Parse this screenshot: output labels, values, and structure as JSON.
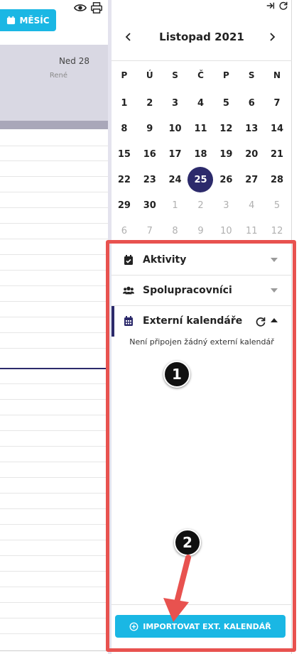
{
  "toolbar": {
    "month_label": "MĚSÍC",
    "view_icon": "eye-icon",
    "print_icon": "printer-icon"
  },
  "day_view": {
    "day_label": "Ned 28",
    "person": "René"
  },
  "mini_calendar": {
    "title": "Listopad 2021",
    "weekdays": [
      "P",
      "Ú",
      "S",
      "Č",
      "P",
      "S",
      "N"
    ],
    "days": [
      {
        "n": "1"
      },
      {
        "n": "2"
      },
      {
        "n": "3"
      },
      {
        "n": "4"
      },
      {
        "n": "5"
      },
      {
        "n": "6"
      },
      {
        "n": "7"
      },
      {
        "n": "8"
      },
      {
        "n": "9"
      },
      {
        "n": "10"
      },
      {
        "n": "11"
      },
      {
        "n": "12"
      },
      {
        "n": "13"
      },
      {
        "n": "14"
      },
      {
        "n": "15"
      },
      {
        "n": "16"
      },
      {
        "n": "17"
      },
      {
        "n": "18"
      },
      {
        "n": "19"
      },
      {
        "n": "20"
      },
      {
        "n": "21"
      },
      {
        "n": "22"
      },
      {
        "n": "23"
      },
      {
        "n": "24"
      },
      {
        "n": "25",
        "today": true
      },
      {
        "n": "26"
      },
      {
        "n": "27"
      },
      {
        "n": "28"
      },
      {
        "n": "29"
      },
      {
        "n": "30"
      },
      {
        "n": "1",
        "muted": true
      },
      {
        "n": "2",
        "muted": true
      },
      {
        "n": "3",
        "muted": true
      },
      {
        "n": "4",
        "muted": true
      },
      {
        "n": "5",
        "muted": true
      },
      {
        "n": "6",
        "muted": true
      },
      {
        "n": "7",
        "muted": true
      },
      {
        "n": "8",
        "muted": true
      },
      {
        "n": "9",
        "muted": true
      },
      {
        "n": "10",
        "muted": true
      },
      {
        "n": "11",
        "muted": true
      },
      {
        "n": "12",
        "muted": true
      }
    ]
  },
  "sections": {
    "activities": "Aktivity",
    "collaborators": "Spolupracovníci",
    "external": "Externí kalendáře",
    "empty_message": "Není připojen žádný externí kalendář"
  },
  "import_button": "IMPORTOVAT EXT. KALENDÁŘ",
  "annotations": {
    "badge1": "1",
    "badge2": "2"
  },
  "colors": {
    "accent": "#1ab7e4",
    "primary": "#2c2a6b",
    "highlight": "#e8524f"
  }
}
